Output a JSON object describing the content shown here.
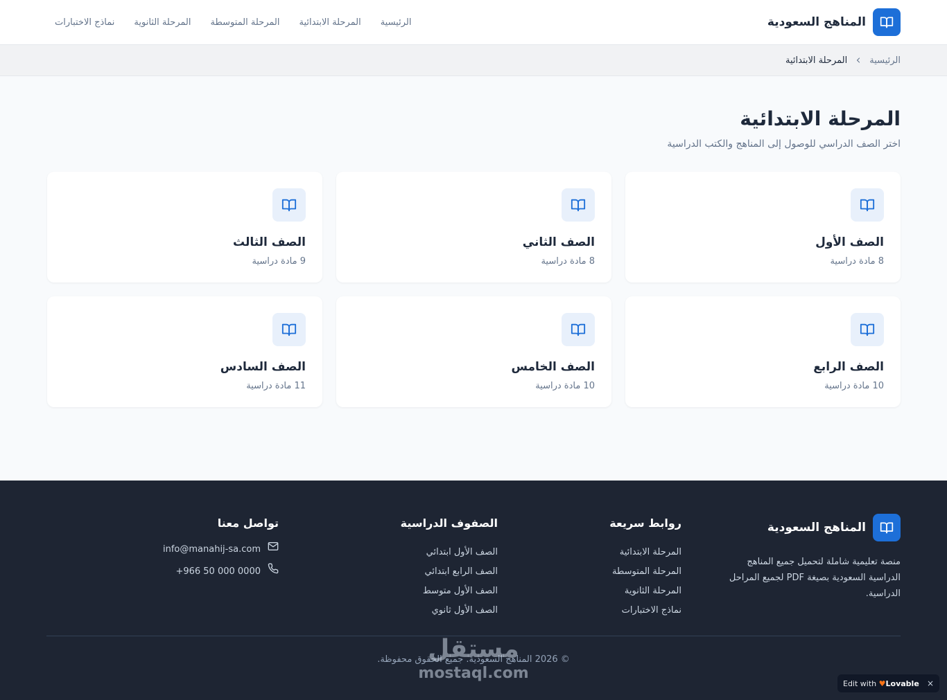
{
  "header": {
    "brand": "المناهج السعودية",
    "brand_icon": "book-open-icon",
    "nav": [
      {
        "label": "الرئيسية"
      },
      {
        "label": "المرحلة الابتدائية"
      },
      {
        "label": "المرحلة المتوسطة"
      },
      {
        "label": "المرحلة الثانوية"
      },
      {
        "label": "نماذج الاختبارات"
      }
    ]
  },
  "breadcrumb": {
    "home": "الرئيسية",
    "current": "المرحلة الابتدائية",
    "separator_icon": "chevron-left-icon"
  },
  "page": {
    "title": "المرحلة الابتدائية",
    "subtitle": "اختر الصف الدراسي للوصول إلى المناهج والكتب الدراسية"
  },
  "grades": [
    {
      "name": "الصف الأول",
      "subjects": "8 مادة دراسية",
      "icon": "book-open-icon"
    },
    {
      "name": "الصف الثاني",
      "subjects": "8 مادة دراسية",
      "icon": "book-open-icon"
    },
    {
      "name": "الصف الثالث",
      "subjects": "9 مادة دراسية",
      "icon": "book-open-icon"
    },
    {
      "name": "الصف الرابع",
      "subjects": "10 مادة دراسية",
      "icon": "book-open-icon"
    },
    {
      "name": "الصف الخامس",
      "subjects": "10 مادة دراسية",
      "icon": "book-open-icon"
    },
    {
      "name": "الصف السادس",
      "subjects": "11 مادة دراسية",
      "icon": "book-open-icon"
    }
  ],
  "footer": {
    "brand": "المناهج السعودية",
    "description": "منصة تعليمية شاملة لتحميل جميع المناهج الدراسية السعودية بصيغة PDF لجميع المراحل الدراسية.",
    "quick_links": {
      "title": "روابط سريعة",
      "items": [
        "المرحلة الابتدائية",
        "المرحلة المتوسطة",
        "المرحلة الثانوية",
        "نماذج الاختبارات"
      ]
    },
    "grades": {
      "title": "الصفوف الدراسية",
      "items": [
        "الصف الأول ابتدائي",
        "الصف الرابع ابتدائي",
        "الصف الأول متوسط",
        "الصف الأول ثانوي"
      ]
    },
    "contact": {
      "title": "تواصل معنا",
      "email": "info@manahij-sa.com",
      "email_icon": "mail-icon",
      "phone": "+966 50 000 0000",
      "phone_icon": "phone-icon"
    },
    "copyright": "© 2026 المناهج السعودية. جميع الحقوق محفوظة."
  },
  "watermark": {
    "arabic": "مستقل",
    "latin": "mostaql.com"
  },
  "badge": {
    "prefix": "Edit with",
    "brand": "Lovable",
    "close": "×"
  },
  "colors": {
    "accent": "#1d6fd8",
    "footer_bg": "#1e2533",
    "page_bg": "#f8fafc"
  }
}
